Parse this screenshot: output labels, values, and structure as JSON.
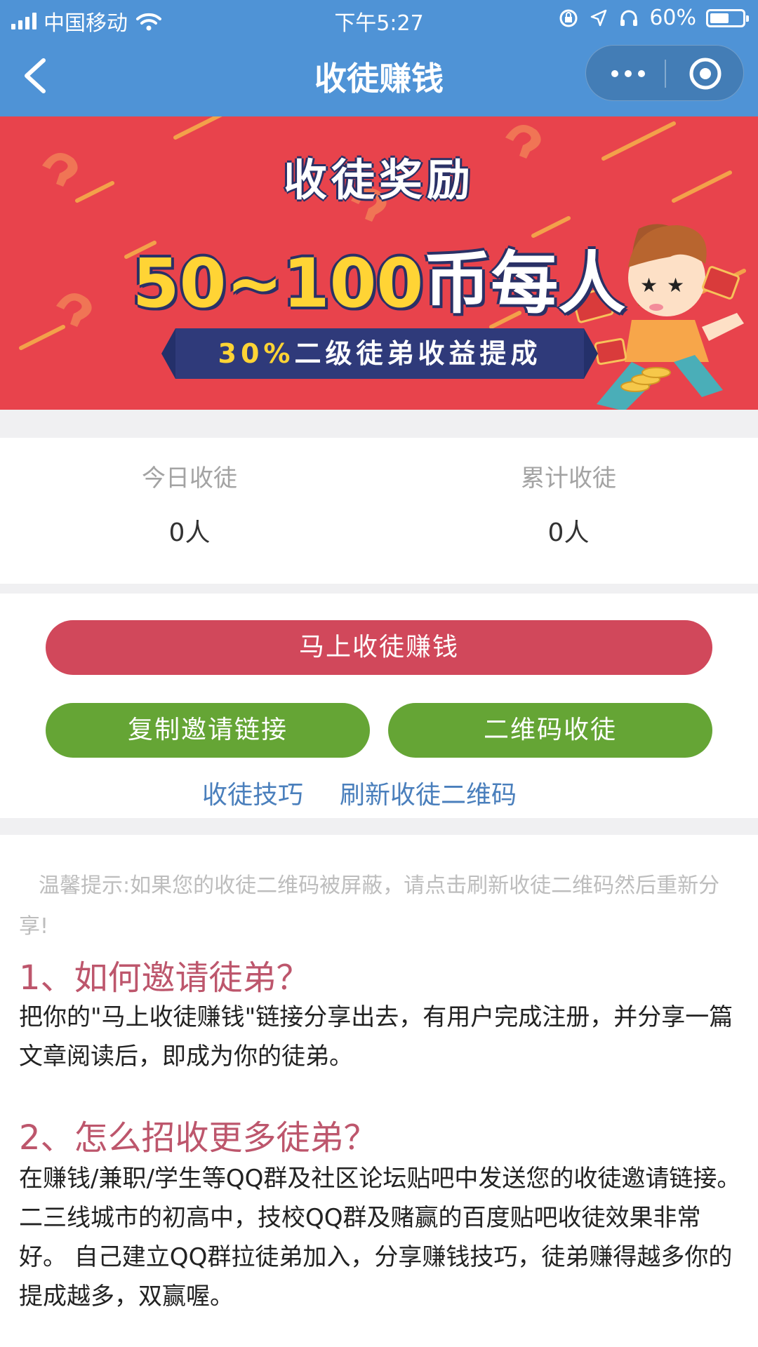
{
  "status_bar": {
    "carrier": "中国移动",
    "time": "下午5:27",
    "battery_percent": "60%",
    "battery_level": 0.6
  },
  "nav": {
    "title": "收徒赚钱",
    "back_icon": "chevron-left-icon",
    "more_icon": "more-dots-icon",
    "close_icon": "target-icon"
  },
  "banner": {
    "title": "收徒奖励",
    "reward_amount": "50~100",
    "reward_unit": "币每人",
    "ribbon_percent": "30%",
    "ribbon_text": "二级徒弟收益提成"
  },
  "stats": [
    {
      "label": "今日收徒",
      "value": "0人"
    },
    {
      "label": "累计收徒",
      "value": "0人"
    }
  ],
  "actions": {
    "primary_button": "马上收徒赚钱",
    "copy_link_button": "复制邀请链接",
    "qr_button": "二维码收徒",
    "tips_link": "收徒技巧",
    "refresh_link": "刷新收徒二维码"
  },
  "content": {
    "tip": "温馨提示:如果您的收徒二维码被屏蔽，请点击刷新收徒二维码然后重新分享!",
    "sections": [
      {
        "question": "1、如何邀请徒弟？",
        "answer": "把你的\"马上收徒赚钱\"链接分享出去，有用户完成注册，并分享一篇文章阅读后，即成为你的徒弟。"
      },
      {
        "question": "2、怎么招收更多徒弟？",
        "answer": "在赚钱/兼职/学生等QQ群及社区论坛贴吧中发送您的收徒邀请链接。 二三线城市的初高中，技校QQ群及赌赢的百度贴吧收徒效果非常好。 自己建立QQ群拉徒弟加入，分享赚钱技巧，徒弟赚得越多你的提成越多，双赢喔。"
      }
    ]
  },
  "colors": {
    "nav_blue": "#4f93d6",
    "banner_red": "#e8434c",
    "primary_red": "#d1485b",
    "green": "#65a535",
    "link_blue": "#4a7fbc",
    "question_rose": "#bd566c"
  }
}
